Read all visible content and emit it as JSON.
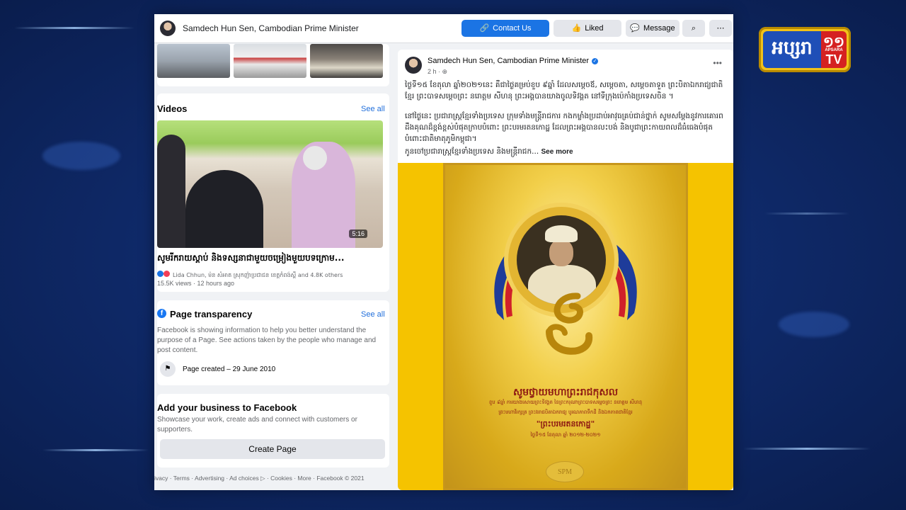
{
  "tv_logo": {
    "text": "អប្សរា",
    "channel": "១១",
    "apsara": "APSARA",
    "tv": "TV"
  },
  "topbar": {
    "page_name": "Samdech Hun Sen, Cambodian Prime Minister",
    "contact_label": "Contact Us",
    "liked_label": "Liked",
    "message_label": "Message"
  },
  "videos": {
    "title": "Videos",
    "see_all": "See all",
    "duration": "5:16",
    "caption": "សូមរីករាយស្ដាប់ និងទស្សនាជាមួយចម្រៀងមួយបទក្រោម...",
    "reactions": "Lida Chhun, ម៉ន សំអាត ស្រុកញ៉ាប្រជាជន ខេត្តកំពង់ស្ពឺ and 4.8K others",
    "meta": "15.5K views · 12 hours ago"
  },
  "transparency": {
    "title": "Page transparency",
    "see_all": "See all",
    "body": "Facebook is showing information to help you better understand the purpose of a Page. See actions taken by the people who manage and post content.",
    "created": "Page created – 29 June 2010"
  },
  "business": {
    "title": "Add your business to Facebook",
    "body": "Showcase your work, create ads and connect with customers or supporters.",
    "button": "Create Page"
  },
  "footer": {
    "text": "ivacy · Terms · Advertising · Ad choices ▷ · Cookies · More · Facebook © 2021"
  },
  "post": {
    "author": "Samdech Hun Sen, Cambodian Prime Minister",
    "time": "2 h · ⊕",
    "para1": "ថ្ងៃទី១៥ ខែតុលា ឆ្នាំ២០២១នេះ គឺជាថ្ងៃគម្រប់ខួប ៩ឆ្នាំ ដែលសម្ដេចឪ, សម្ដេចតា, សម្ដេចតាទួត ព្រះបិតាឯករាជ្យជាតិខ្មែរ ព្រះបាទសម្ដេចព្រះ នរោត្តម សីហនុ ព្រះអង្គបានយាងចូលទិវង្គត នៅទីក្រុងប៉េកាំងប្រទេសចិន ។",
    "para2": "នៅថ្ងៃនេះ ប្រជារាស្ត្រខ្មែរទាំងប្រទេស ក្រុមទាំងមន្ត្រីរាជការ កងកម្លាំងប្រដាប់អាវុធគ្រប់ជាន់ថ្នាក់ សូមសម្ដែងនូវការគោរពដឹងគុណដ៏ខ្ពង់ខ្ពស់បំផុតក្រាបបំពោះ ព្រះបរមរតនកោដ្ឋ ដែលព្រះអង្គបានលះបង់ និងបូជាព្រះកាយពលដ៏ធំធេងបំផុតបំពោះជាតិមាតុភូមិកម្ពុជា។",
    "para3": "កូនចៅប្រជារាស្ត្រខ្មែរទាំងប្រទេស និងមន្ត្រីរាជក...",
    "see_more": "See more"
  },
  "poster": {
    "title": "សូមថ្វាយមហាព្រះរាជកុសល",
    "line1": "ខួប ៩ឆ្នាំ ការយាងសោយព្រះទិវង្គត នៃព្រះករុណាព្រះបាទសម្ដេចព្រះ នរោត្តម សីហនុ",
    "line2": "ព្រះមហាវីរក្សត្រ ព្រះវររាជបិតាឯករាជ្យ បូរណភាពទឹកដី និងឯកភាពជាតិខ្មែរ",
    "name": "\"ព្រះបរមរតនកោដ្ឋ\"",
    "date": "ថ្ងៃទី១៥ ខែតុលា ឆ្នាំ ២០១២-២០២១",
    "logo": "SPM"
  }
}
